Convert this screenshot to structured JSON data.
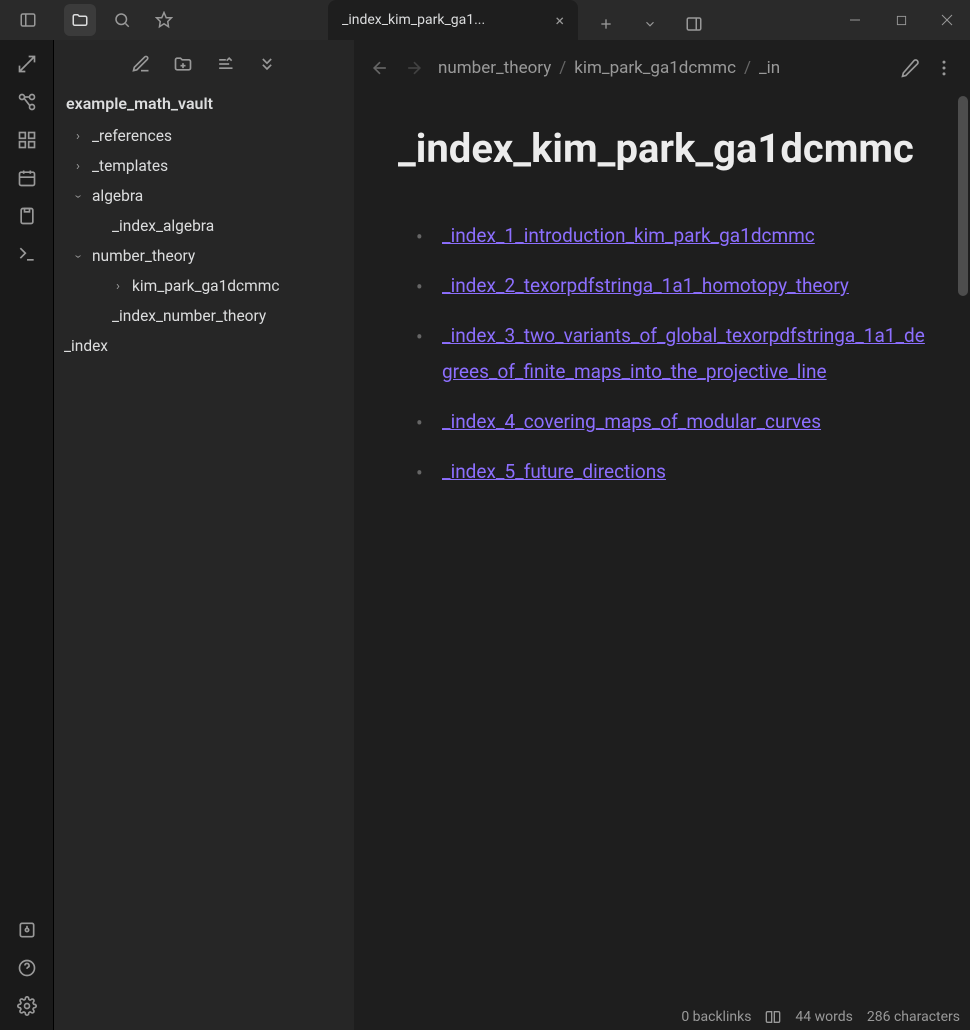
{
  "titlebar": {
    "active_tab": "_index_kim_park_ga1...",
    "close_glyph": "×"
  },
  "sidebar": {
    "vault_name": "example_math_vault",
    "tree": {
      "references": "_references",
      "templates": "_templates",
      "algebra": "algebra",
      "index_algebra": "_index_algebra",
      "number_theory": "number_theory",
      "kim_park": "kim_park_ga1dcmmc",
      "index_nt": "_index_number_theory",
      "index_root": "_index"
    }
  },
  "crumbs": {
    "c1": "number_theory",
    "c2": "kim_park_ga1dcmmc",
    "c3": "_in"
  },
  "note": {
    "title": "_index_kim_park_ga1dcmmc",
    "links": [
      "_index_1_introduction_kim_park_ga1dcmmc",
      "_index_2_texorpdfstringa_1a1_homotopy_theory",
      "_index_3_two_variants_of_global_texorpdfstringa_1a1_degrees_of_finite_maps_into_the_projective_line",
      "_index_4_covering_maps_of_modular_curves",
      "_index_5_future_directions"
    ]
  },
  "status": {
    "backlinks": "0 backlinks",
    "words": "44 words",
    "chars": "286 characters"
  }
}
